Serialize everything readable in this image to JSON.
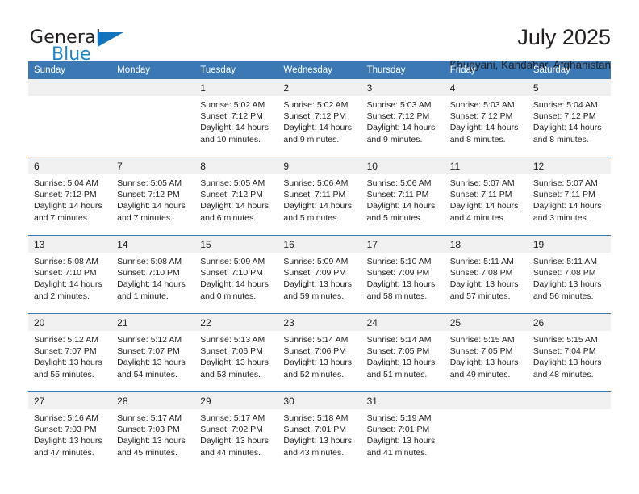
{
  "brand": {
    "name_part1": "General",
    "name_part2": "Blue",
    "flag_icon": "blue-flag-triangle",
    "accent_color": "#1473bd",
    "secondary_color": "#1d84c9"
  },
  "header": {
    "title": "July 2025",
    "subtitle": "Khugyani, Kandahar, Afghanistan"
  },
  "calendar": {
    "header_color": "#3c78b4",
    "daynum_bg": "#f0f0f0",
    "weekday_headers": [
      "Sunday",
      "Monday",
      "Tuesday",
      "Wednesday",
      "Thursday",
      "Friday",
      "Saturday"
    ],
    "weeks": [
      [
        {
          "day": "",
          "sunrise": "",
          "sunset": "",
          "daylight": ""
        },
        {
          "day": "",
          "sunrise": "",
          "sunset": "",
          "daylight": ""
        },
        {
          "day": "1",
          "sunrise": "Sunrise: 5:02 AM",
          "sunset": "Sunset: 7:12 PM",
          "daylight": "Daylight: 14 hours and 10 minutes."
        },
        {
          "day": "2",
          "sunrise": "Sunrise: 5:02 AM",
          "sunset": "Sunset: 7:12 PM",
          "daylight": "Daylight: 14 hours and 9 minutes."
        },
        {
          "day": "3",
          "sunrise": "Sunrise: 5:03 AM",
          "sunset": "Sunset: 7:12 PM",
          "daylight": "Daylight: 14 hours and 9 minutes."
        },
        {
          "day": "4",
          "sunrise": "Sunrise: 5:03 AM",
          "sunset": "Sunset: 7:12 PM",
          "daylight": "Daylight: 14 hours and 8 minutes."
        },
        {
          "day": "5",
          "sunrise": "Sunrise: 5:04 AM",
          "sunset": "Sunset: 7:12 PM",
          "daylight": "Daylight: 14 hours and 8 minutes."
        }
      ],
      [
        {
          "day": "6",
          "sunrise": "Sunrise: 5:04 AM",
          "sunset": "Sunset: 7:12 PM",
          "daylight": "Daylight: 14 hours and 7 minutes."
        },
        {
          "day": "7",
          "sunrise": "Sunrise: 5:05 AM",
          "sunset": "Sunset: 7:12 PM",
          "daylight": "Daylight: 14 hours and 7 minutes."
        },
        {
          "day": "8",
          "sunrise": "Sunrise: 5:05 AM",
          "sunset": "Sunset: 7:12 PM",
          "daylight": "Daylight: 14 hours and 6 minutes."
        },
        {
          "day": "9",
          "sunrise": "Sunrise: 5:06 AM",
          "sunset": "Sunset: 7:11 PM",
          "daylight": "Daylight: 14 hours and 5 minutes."
        },
        {
          "day": "10",
          "sunrise": "Sunrise: 5:06 AM",
          "sunset": "Sunset: 7:11 PM",
          "daylight": "Daylight: 14 hours and 5 minutes."
        },
        {
          "day": "11",
          "sunrise": "Sunrise: 5:07 AM",
          "sunset": "Sunset: 7:11 PM",
          "daylight": "Daylight: 14 hours and 4 minutes."
        },
        {
          "day": "12",
          "sunrise": "Sunrise: 5:07 AM",
          "sunset": "Sunset: 7:11 PM",
          "daylight": "Daylight: 14 hours and 3 minutes."
        }
      ],
      [
        {
          "day": "13",
          "sunrise": "Sunrise: 5:08 AM",
          "sunset": "Sunset: 7:10 PM",
          "daylight": "Daylight: 14 hours and 2 minutes."
        },
        {
          "day": "14",
          "sunrise": "Sunrise: 5:08 AM",
          "sunset": "Sunset: 7:10 PM",
          "daylight": "Daylight: 14 hours and 1 minute."
        },
        {
          "day": "15",
          "sunrise": "Sunrise: 5:09 AM",
          "sunset": "Sunset: 7:10 PM",
          "daylight": "Daylight: 14 hours and 0 minutes."
        },
        {
          "day": "16",
          "sunrise": "Sunrise: 5:09 AM",
          "sunset": "Sunset: 7:09 PM",
          "daylight": "Daylight: 13 hours and 59 minutes."
        },
        {
          "day": "17",
          "sunrise": "Sunrise: 5:10 AM",
          "sunset": "Sunset: 7:09 PM",
          "daylight": "Daylight: 13 hours and 58 minutes."
        },
        {
          "day": "18",
          "sunrise": "Sunrise: 5:11 AM",
          "sunset": "Sunset: 7:08 PM",
          "daylight": "Daylight: 13 hours and 57 minutes."
        },
        {
          "day": "19",
          "sunrise": "Sunrise: 5:11 AM",
          "sunset": "Sunset: 7:08 PM",
          "daylight": "Daylight: 13 hours and 56 minutes."
        }
      ],
      [
        {
          "day": "20",
          "sunrise": "Sunrise: 5:12 AM",
          "sunset": "Sunset: 7:07 PM",
          "daylight": "Daylight: 13 hours and 55 minutes."
        },
        {
          "day": "21",
          "sunrise": "Sunrise: 5:12 AM",
          "sunset": "Sunset: 7:07 PM",
          "daylight": "Daylight: 13 hours and 54 minutes."
        },
        {
          "day": "22",
          "sunrise": "Sunrise: 5:13 AM",
          "sunset": "Sunset: 7:06 PM",
          "daylight": "Daylight: 13 hours and 53 minutes."
        },
        {
          "day": "23",
          "sunrise": "Sunrise: 5:14 AM",
          "sunset": "Sunset: 7:06 PM",
          "daylight": "Daylight: 13 hours and 52 minutes."
        },
        {
          "day": "24",
          "sunrise": "Sunrise: 5:14 AM",
          "sunset": "Sunset: 7:05 PM",
          "daylight": "Daylight: 13 hours and 51 minutes."
        },
        {
          "day": "25",
          "sunrise": "Sunrise: 5:15 AM",
          "sunset": "Sunset: 7:05 PM",
          "daylight": "Daylight: 13 hours and 49 minutes."
        },
        {
          "day": "26",
          "sunrise": "Sunrise: 5:15 AM",
          "sunset": "Sunset: 7:04 PM",
          "daylight": "Daylight: 13 hours and 48 minutes."
        }
      ],
      [
        {
          "day": "27",
          "sunrise": "Sunrise: 5:16 AM",
          "sunset": "Sunset: 7:03 PM",
          "daylight": "Daylight: 13 hours and 47 minutes."
        },
        {
          "day": "28",
          "sunrise": "Sunrise: 5:17 AM",
          "sunset": "Sunset: 7:03 PM",
          "daylight": "Daylight: 13 hours and 45 minutes."
        },
        {
          "day": "29",
          "sunrise": "Sunrise: 5:17 AM",
          "sunset": "Sunset: 7:02 PM",
          "daylight": "Daylight: 13 hours and 44 minutes."
        },
        {
          "day": "30",
          "sunrise": "Sunrise: 5:18 AM",
          "sunset": "Sunset: 7:01 PM",
          "daylight": "Daylight: 13 hours and 43 minutes."
        },
        {
          "day": "31",
          "sunrise": "Sunrise: 5:19 AM",
          "sunset": "Sunset: 7:01 PM",
          "daylight": "Daylight: 13 hours and 41 minutes."
        },
        {
          "day": "",
          "sunrise": "",
          "sunset": "",
          "daylight": ""
        },
        {
          "day": "",
          "sunrise": "",
          "sunset": "",
          "daylight": ""
        }
      ]
    ]
  }
}
